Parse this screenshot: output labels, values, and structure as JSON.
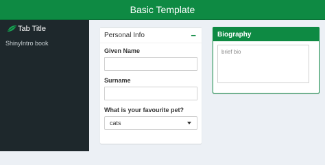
{
  "header": {
    "title": "Basic Template"
  },
  "sidebar": {
    "brand_icon": "leaf-logo-icon",
    "title": "Tab Title",
    "subtitle": "ShinyIntro book"
  },
  "personal_info": {
    "title": "Personal Info",
    "collapse_icon": "minus-icon",
    "given_name": {
      "label": "Given Name",
      "value": "",
      "placeholder": ""
    },
    "surname": {
      "label": "Surname",
      "value": "",
      "placeholder": ""
    },
    "pet": {
      "label": "What is your favourite pet?",
      "selected": "cats"
    }
  },
  "biography": {
    "title": "Biography",
    "placeholder": "brief bio"
  },
  "colors": {
    "brand": "#0e8a43",
    "sidebar": "#1e282c",
    "background": "#ecf0f5"
  }
}
